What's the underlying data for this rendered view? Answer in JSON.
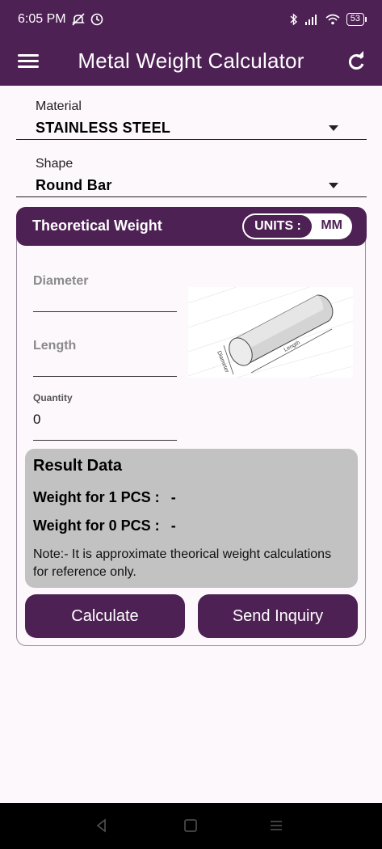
{
  "status_bar": {
    "time": "6:05 PM",
    "battery": "53",
    "icons": [
      "no-alarm-icon",
      "clock-icon",
      "bluetooth-icon",
      "signal-icon",
      "wifi-icon",
      "battery-icon"
    ]
  },
  "app_bar": {
    "title": "Metal Weight Calculator",
    "menu_icon": "menu-icon",
    "refresh_icon": "refresh-icon"
  },
  "material": {
    "label": "Material",
    "value": "STAINLESS STEEL"
  },
  "shape": {
    "label": "Shape",
    "value": "Round Bar"
  },
  "card": {
    "title": "Theoretical Weight",
    "units_label": "UNITS :",
    "units_value": "MM"
  },
  "inputs": {
    "diameter_label": "Diameter",
    "length_label": "Length",
    "quantity_label": "Quantity",
    "quantity_value": "0"
  },
  "diagram": {
    "diameter_text": "Diameter",
    "length_text": "Length"
  },
  "result": {
    "title": "Result Data",
    "row1_label": "Weight for 1 PCS :",
    "row1_value": "-",
    "row2_label": "Weight for 0 PCS :",
    "row2_value": "-",
    "note": "Note:- It is approximate theorical weight calculations for reference only."
  },
  "buttons": {
    "calculate": "Calculate",
    "send_inquiry": "Send Inquiry"
  },
  "colors": {
    "primary": "#4E2154",
    "background": "#FDF8FC",
    "result_bg": "#C2C2C2"
  }
}
